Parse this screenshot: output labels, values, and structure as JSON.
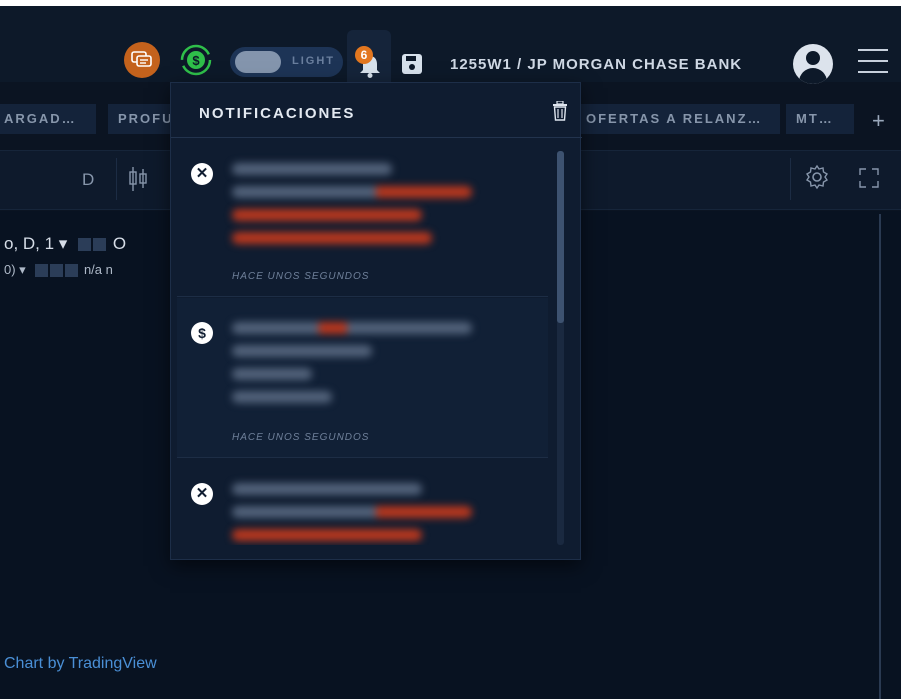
{
  "header": {
    "toggle_label": "LIGHT",
    "notification_count": "6",
    "account_label": "1255W1 / JP MORGAN CHASE BANK"
  },
  "tabs": [
    {
      "label": "ARGAD…"
    },
    {
      "label": "PROFU"
    },
    {
      "label": "OFERTAS A RELANZ…"
    },
    {
      "label": "MT…"
    }
  ],
  "toolbar": {
    "interval_label": "D"
  },
  "chart": {
    "legend_line1_symbol": "o, D, 1 ▾",
    "legend_line1_tail": "O",
    "legend_line2_prefix": "0) ▾",
    "legend_line2_values": "n/a  n",
    "credit": "Chart by TradingView"
  },
  "notifications": {
    "title": "NOTIFICACIONES",
    "items": [
      {
        "type": "rejected",
        "icon": "x-circle-icon",
        "time": "HACE UNOS SEGUNDOS"
      },
      {
        "type": "order",
        "icon": "dollar-bubble-icon",
        "time": "HACE UNOS SEGUNDOS"
      },
      {
        "type": "rejected",
        "icon": "x-circle-icon",
        "time": ""
      }
    ]
  },
  "colors": {
    "accent_orange": "#e3771f",
    "chat_orange": "#c4621c",
    "money_green": "#2fbf4a",
    "highlight_red": "#b8371e"
  }
}
